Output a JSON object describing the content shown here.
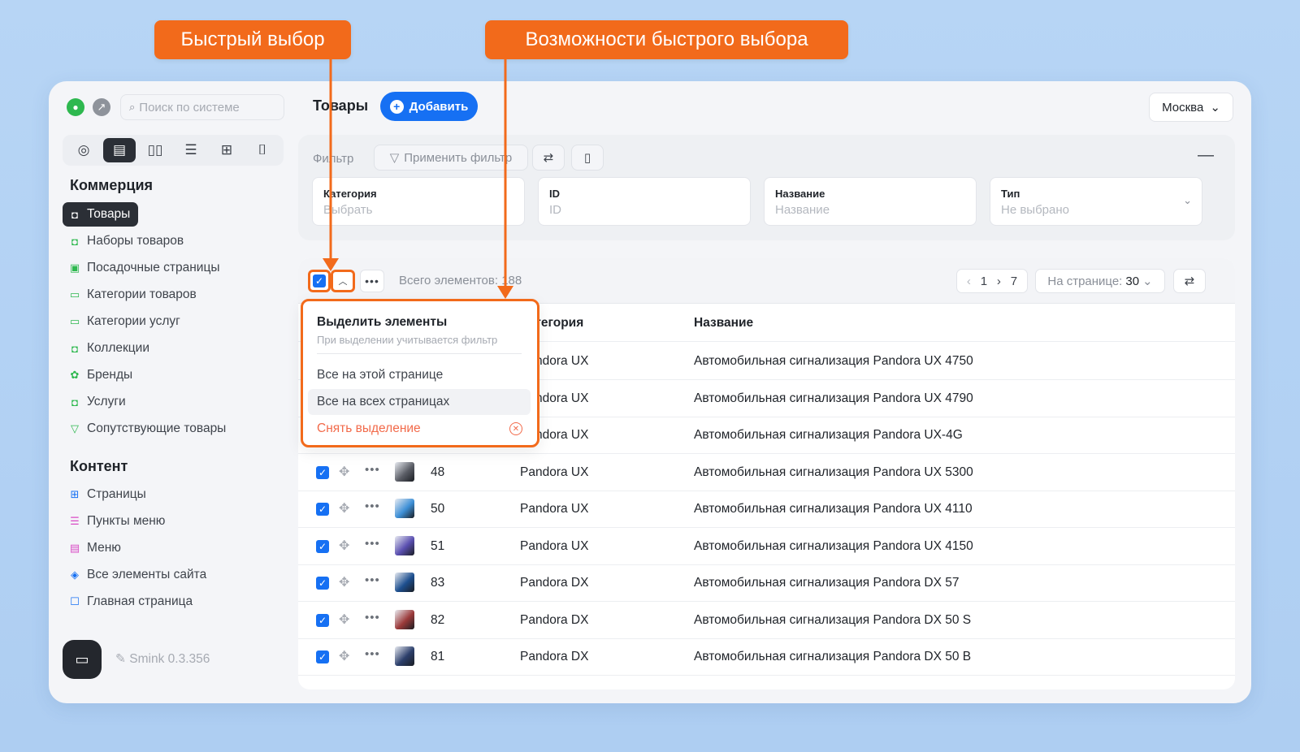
{
  "callouts": {
    "quick_select": "Быстрый выбор",
    "quick_select_options": "Возможности быстрого выбора"
  },
  "sidebar": {
    "search_placeholder": "Поиск по системе",
    "module_tabs": [
      "dashboard-icon",
      "catalog-icon",
      "book-icon",
      "sliders-icon",
      "plus-square-icon",
      "brush-icon"
    ],
    "section_commerce": "Коммерция",
    "commerce_items": [
      {
        "label": "Товары",
        "icon": "bag-icon",
        "active": true
      },
      {
        "label": "Наборы товаров",
        "icon": "bag-set-icon"
      },
      {
        "label": "Посадочные страницы",
        "icon": "landing-icon"
      },
      {
        "label": "Категории товаров",
        "icon": "category-icon"
      },
      {
        "label": "Категории услуг",
        "icon": "category-icon"
      },
      {
        "label": "Коллекции",
        "icon": "collection-icon"
      },
      {
        "label": "Бренды",
        "icon": "brand-icon"
      },
      {
        "label": "Услуги",
        "icon": "service-icon"
      },
      {
        "label": "Сопутствующие товары",
        "icon": "related-icon"
      }
    ],
    "section_content": "Контент",
    "content_items": [
      {
        "label": "Страницы",
        "icon": "grid-icon"
      },
      {
        "label": "Пункты меню",
        "icon": "list-icon"
      },
      {
        "label": "Меню",
        "icon": "menu-icon"
      },
      {
        "label": "Все элементы сайта",
        "icon": "layers-icon"
      },
      {
        "label": "Главная страница",
        "icon": "square-icon"
      }
    ],
    "version": "Smink 0.3.356"
  },
  "header": {
    "title": "Товары",
    "add_label": "Добавить",
    "city": "Москва"
  },
  "filter": {
    "label": "Фильтр",
    "apply_label": "Применить фильтр",
    "fields": [
      {
        "label": "Категория",
        "placeholder": "Выбрать"
      },
      {
        "label": "ID",
        "placeholder": "ID"
      },
      {
        "label": "Название",
        "placeholder": "Название"
      },
      {
        "label": "Тип",
        "placeholder": "Не выбрано"
      }
    ]
  },
  "table": {
    "total_prefix": "Всего элементов:",
    "total": "188",
    "page_current": "1",
    "page_total": "7",
    "per_page_label": "На странице:",
    "per_page": "30",
    "columns": [
      "Категория",
      "Название"
    ],
    "rows": [
      {
        "id": "",
        "category": "Pandora UX",
        "name": "Автомобильная сигнализация Pandora UX 4750",
        "thumb": "#4a7fc1"
      },
      {
        "id": "",
        "category": "Pandora UX",
        "name": "Автомобильная сигнализация Pandora UX 4790",
        "thumb": "#3565a8"
      },
      {
        "id": "",
        "category": "Pandora UX",
        "name": "Автомобильная сигнализация Pandora UX-4G",
        "thumb": "#2a4f88"
      },
      {
        "id": "48",
        "category": "Pandora UX",
        "name": "Автомобильная сигнализация Pandora UX 5300",
        "thumb": "#5b5e66"
      },
      {
        "id": "50",
        "category": "Pandora UX",
        "name": "Автомобильная сигнализация Pandora UX 4110",
        "thumb": "#3d8fd6"
      },
      {
        "id": "51",
        "category": "Pandora UX",
        "name": "Автомобильная сигнализация Pandora UX 4150",
        "thumb": "#5a4fb0"
      },
      {
        "id": "83",
        "category": "Pandora DX",
        "name": "Автомобильная сигнализация Pandora DX 57",
        "thumb": "#1d4f8f"
      },
      {
        "id": "82",
        "category": "Pandora DX",
        "name": "Автомобильная сигнализация Pandora DX 50 S",
        "thumb": "#9b3a3a"
      },
      {
        "id": "81",
        "category": "Pandora DX",
        "name": "Автомобильная сигнализация Pandora DX 50 B",
        "thumb": "#2c3f6b"
      }
    ]
  },
  "popup": {
    "title": "Выделить элементы",
    "subtitle": "При выделении учитывается фильтр",
    "options": [
      "Все на этой странице",
      "Все на всех страницах"
    ],
    "clear": "Снять выделение"
  },
  "colors": {
    "accent": "#1670f3",
    "callout": "#f26a1b",
    "danger": "#f26a4a"
  }
}
